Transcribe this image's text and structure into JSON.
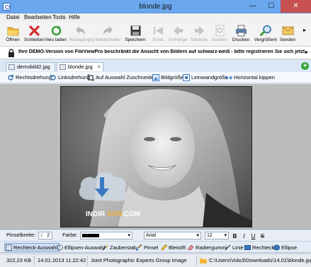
{
  "window": {
    "title": "blonde.jpg",
    "min": "—",
    "max": "☐",
    "close": "✕"
  },
  "menu": [
    "Datei",
    "Bearbeiten",
    "Tools",
    "Hilfe"
  ],
  "toolbar": [
    {
      "label": "Öffnen",
      "icon": "folder-icon",
      "enabled": true
    },
    {
      "label": "Schließen",
      "icon": "close-icon",
      "enabled": true
    },
    {
      "label": "Neu laden",
      "icon": "reload-icon",
      "enabled": true
    },
    {
      "label": "Rückgängig",
      "icon": "undo-icon",
      "enabled": false
    },
    {
      "label": "Wiederholen",
      "icon": "redo-icon",
      "enabled": false
    },
    {
      "label": "Speichern",
      "icon": "save-icon",
      "enabled": true
    },
    {
      "label": "Erste",
      "icon": "first-icon",
      "enabled": false
    },
    {
      "label": "Vorherige",
      "icon": "previous-icon",
      "enabled": false
    },
    {
      "label": "Nächste",
      "icon": "next-icon",
      "enabled": false
    },
    {
      "label": "Suchen",
      "icon": "search-doc-icon",
      "enabled": false
    },
    {
      "label": "Drucken",
      "icon": "printer-icon",
      "enabled": true
    },
    {
      "label": "Vergrößern",
      "icon": "zoom-icon",
      "enabled": true
    },
    {
      "label": "Senden",
      "icon": "mail-icon",
      "enabled": true
    }
  ],
  "demo_notice": "Ihre DEMO-Version von FileViewPro beschränkt die Ansicht von Bildern auf schwarz-weiß - bitte registrieren Sie sich jetzt, um Bilder w",
  "tabs": [
    {
      "label": "demobild2.jpg",
      "active": false
    },
    {
      "label": "blonde.jpg",
      "active": true
    }
  ],
  "actions": [
    {
      "label": "Rechtsdrehung",
      "icon": "rotate-right-icon"
    },
    {
      "label": "Linksdrehung",
      "icon": "rotate-left-icon"
    },
    {
      "label": "Auf Auswahl Zuschneiden",
      "icon": "crop-icon"
    },
    {
      "label": "Bildgröße",
      "icon": "image-size-icon"
    },
    {
      "label": "Leinwandgröße",
      "icon": "canvas-size-icon"
    },
    {
      "label": "Horizontal kippen",
      "icon": "flip-horizontal-icon"
    }
  ],
  "watermark": {
    "brand_a": "INDIR",
    "brand_b": "SON",
    "brand_c": ".COM"
  },
  "props": {
    "pinsel_label": "Pinselbreite:",
    "pinsel_value": "2",
    "farbe_label": "Farbe:",
    "font_value": "Arial",
    "size_value": "12",
    "bold": "B",
    "italic": "I",
    "underline": "U",
    "strike": "S"
  },
  "tools": [
    {
      "label": "Rechteck-Auswahl",
      "icon": "rect-select-icon",
      "active": true
    },
    {
      "label": "Ellipsen-Auswahl",
      "icon": "ellipse-select-icon",
      "active": false
    },
    {
      "label": "Zauberstab",
      "icon": "magic-wand-icon",
      "active": false
    },
    {
      "label": "Pinsel",
      "icon": "brush-icon",
      "active": false
    },
    {
      "label": "Bleistift",
      "icon": "pencil-icon",
      "active": false
    },
    {
      "label": "Radiergummi",
      "icon": "eraser-icon",
      "active": false
    },
    {
      "label": "Linie",
      "icon": "line-icon",
      "active": false
    },
    {
      "label": "Rechteck",
      "icon": "rectangle-icon",
      "active": false
    },
    {
      "label": "Ellipse",
      "icon": "ellipse-icon",
      "active": false
    }
  ],
  "status": {
    "size": "322,23 KB",
    "date": "14.01.2013 11:22:42",
    "type": "Joint Photographic Experts Group Image",
    "path": "C:\\Users\\Volo3\\Downloads\\14.01\\blonde.jpg"
  },
  "colors": {
    "titlebar": "#6aa7ee",
    "close": "#c75050",
    "accent": "#3a78c4"
  }
}
